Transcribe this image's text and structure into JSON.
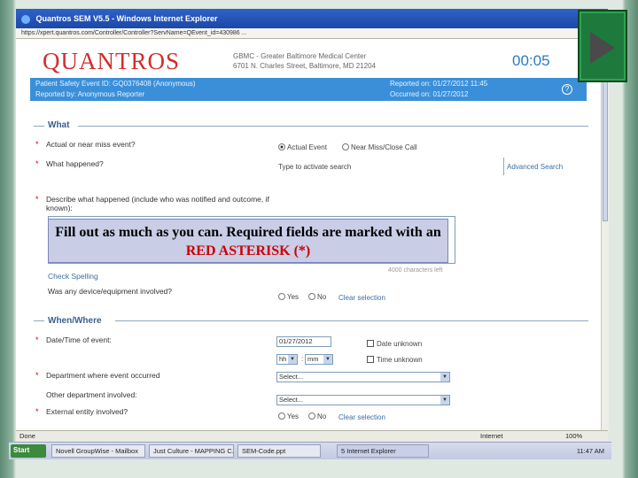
{
  "window": {
    "title": "Quantros SEM V5.5 - Windows Internet Explorer",
    "address": "https://xpert.quantros.com/Controller/Controller?ServName=QEvent_id=430986 ..."
  },
  "header": {
    "logo": "QUANTROS",
    "org_name": "GBMC - Greater Baltimore Medical Center",
    "org_address": "6701 N. Charles Street, Baltimore, MD 21204",
    "timer": "00:05"
  },
  "event_bar": {
    "event_id": "Patient Safety Event ID: GQ0376408 (Anonymous)",
    "reported_by": "Reported by: Anonymous Reporter",
    "reported_on": "Reported on: 01/27/2012 11:45",
    "occurred_on": "Occurred on: 01/27/2012",
    "help": "?"
  },
  "sections": {
    "what": "What",
    "when_where": "When/Where"
  },
  "form": {
    "actual_or_near_miss": "Actual or near miss event?",
    "actual_event": "Actual Event",
    "near_miss": "Near Miss/Close Call",
    "what_happened": "What happened?",
    "type_to_search": "Type to activate search",
    "advanced_search": "Advanced Search",
    "describe": "Describe what happened (include who was notified and outcome, if known):",
    "check_spelling": "Check Spelling",
    "chars_left": "4000 characters left",
    "device_involved": "Was any device/equipment involved?",
    "yes": "Yes",
    "no": "No",
    "clear_selection": "Clear selection",
    "date_time": "Date/Time of event:",
    "date_value": "01/27/2012",
    "date_unknown": "Date unknown",
    "time_unknown": "Time unknown",
    "hour": "hh",
    "minute": "mm",
    "department": "Department where event occurred",
    "other_department": "Other department involved:",
    "external_entity": "External entity involved?",
    "select_placeholder": "Select...",
    "colon": ":"
  },
  "callout": {
    "text_main": "Fill out as much as you can.  Required fields are marked with an ",
    "text_red": "RED ASTERISK (*)"
  },
  "status_bar": {
    "status": "Done",
    "zone": "Internet",
    "zoom": "100%"
  },
  "taskbar": {
    "start": "Start",
    "items": [
      "Novell GroupWise - Mailbox",
      "Just Culture - MAPPING C...",
      "SEM-Code.ppt",
      "5 Internet Explorer"
    ],
    "time": "11:47 AM"
  },
  "colors": {
    "accent": "#3a8fd8",
    "brand_red": "#d42d2d",
    "play_green": "#1e7a3c"
  }
}
